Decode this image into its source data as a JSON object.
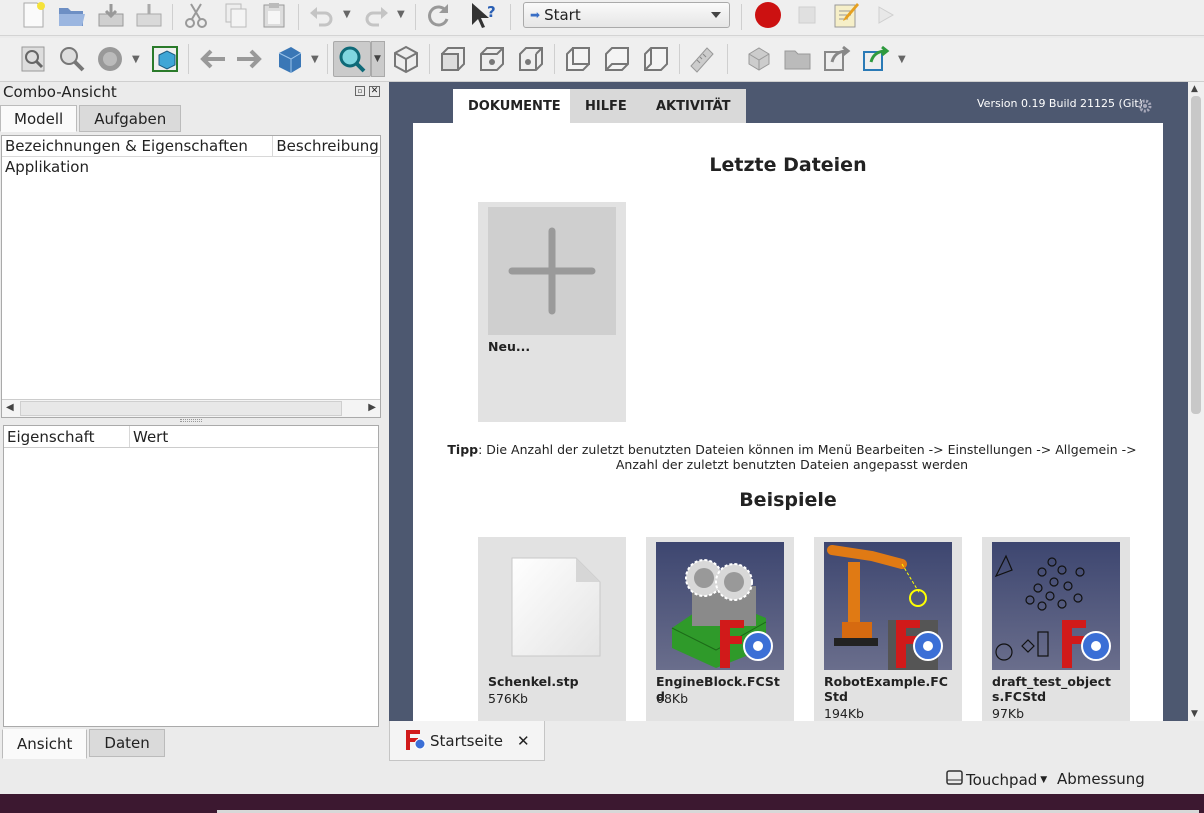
{
  "toolbar": {
    "workbench_selected": "Start",
    "icons": [
      "new-document-icon",
      "open-folder-icon",
      "save-icon",
      "save-as-icon",
      "cut-icon",
      "copy-icon",
      "paste-icon",
      "undo-icon",
      "redo-icon",
      "refresh-icon",
      "whats-this-icon",
      "macro-record-icon",
      "macro-stop-icon",
      "macro-edit-icon",
      "macro-play-icon"
    ]
  },
  "view_toolbar": {
    "icons": [
      "fit-all-icon",
      "fit-selection-icon",
      "draw-style-icon",
      "bounding-box-icon",
      "back-icon",
      "forward-icon",
      "navigation-cube-icon",
      "sync-view-icon",
      "isometric-icon",
      "front-view-icon",
      "top-view-icon",
      "right-view-icon",
      "rear-view-icon",
      "bottom-view-icon",
      "left-view-icon",
      "measure-icon",
      "part-icon",
      "group-icon",
      "link-icon",
      "link-actions-icon"
    ]
  },
  "combo": {
    "title": "Combo-Ansicht",
    "tabs": [
      {
        "label": "Modell"
      },
      {
        "label": "Aufgaben"
      }
    ],
    "tree_headers": [
      "Bezeichnungen & Eigenschaften",
      "Beschreibung"
    ],
    "tree_items": [
      "Applikation"
    ],
    "prop_headers": [
      "Eigenschaft",
      "Wert"
    ],
    "bottom_tabs": [
      {
        "label": "Ansicht"
      },
      {
        "label": "Daten"
      }
    ]
  },
  "start": {
    "tabs": [
      {
        "label": "DOKUMENTE"
      },
      {
        "label": "HILFE"
      },
      {
        "label": "AKTIVITÄT"
      }
    ],
    "version": "Version 0.19 Build 21125 (Git)",
    "recent_title": "Letzte Dateien",
    "new_label": "Neu...",
    "tip_bold": "Tipp",
    "tip_text": ": Die Anzahl der zuletzt benutzten Dateien können im Menü Bearbeiten -> Einstellungen -> Allgemein -> Anzahl der zuletzt benutzten Dateien angepasst werden",
    "examples_title": "Beispiele",
    "examples": [
      {
        "name": "Schenkel.stp",
        "size": "576Kb"
      },
      {
        "name": "EngineBlock.FCStd",
        "size": "68Kb"
      },
      {
        "name": "RobotExample.FCStd",
        "size": "194Kb"
      },
      {
        "name": "draft_test_objects.FCStd",
        "size": "97Kb"
      }
    ]
  },
  "doc_tab": {
    "label": "Startseite"
  },
  "status": {
    "nav_style": "Touchpad",
    "units": "Abmessung"
  },
  "colors": {
    "panel_bg": "#4d5870",
    "card_bg": "#e2e2e2",
    "record_red": "#cc1111",
    "freecad_red": "#d11a1a",
    "gear_blue": "#3b6fd6"
  }
}
